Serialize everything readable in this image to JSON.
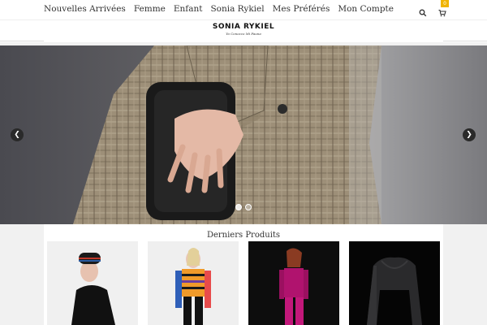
{
  "nav": {
    "items": [
      "Nouvelles Arrivées",
      "Femme",
      "Enfant",
      "Sonia Rykiel",
      "Mes Préférés",
      "Mon Compte"
    ],
    "search_icon": "search-icon",
    "cart_icon": "cart-icon",
    "cart_count": "0"
  },
  "brand": {
    "logo": "SONIA RYKIEL",
    "tagline": "Yo Conozco Mi Fauna"
  },
  "hero": {
    "prev_icon": "chevron-left-icon",
    "next_icon": "chevron-right-icon",
    "active_slide": 1,
    "slide_count": 2
  },
  "products": {
    "title": "Derniers Produits"
  },
  "colors": {
    "accent": "#f0b400"
  }
}
